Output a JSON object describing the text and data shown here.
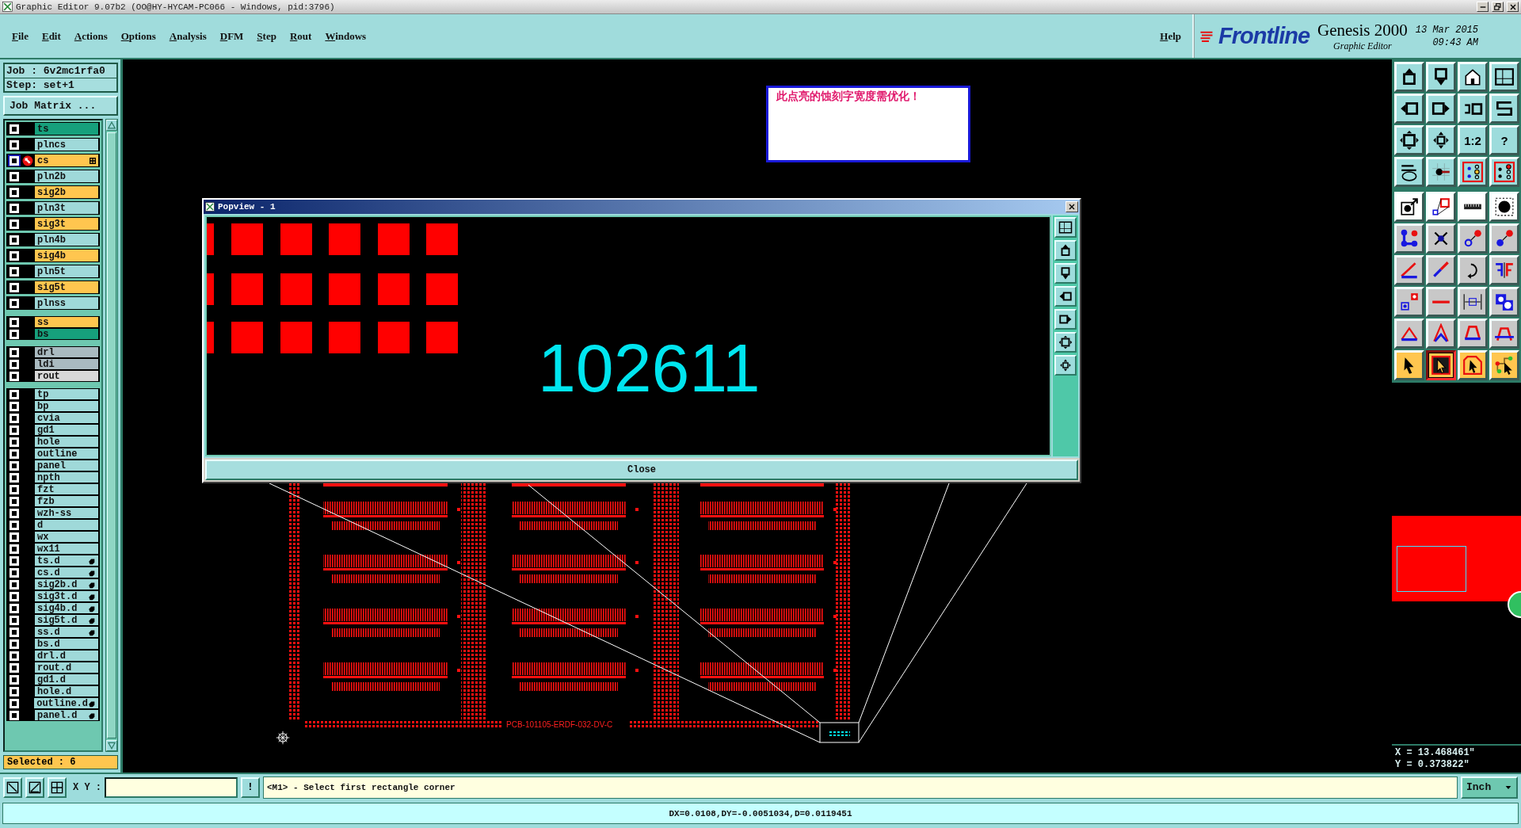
{
  "title_bar": {
    "title": "Graphic Editor 9.07b2 (OO@HY-HYCAM-PC066 - Windows, pid:3796)"
  },
  "menu": [
    "File",
    "Edit",
    "Actions",
    "Options",
    "Analysis",
    "DFM",
    "Step",
    "Rout",
    "Windows"
  ],
  "help": "Help",
  "brand": {
    "logo": "Frontline",
    "product": "Genesis 2000",
    "subtitle": "Graphic Editor",
    "date": "13 Mar 2015",
    "time": "09:43 AM"
  },
  "job": {
    "job": "Job : 6v2mc1rfa0",
    "step": "Step: set+1",
    "matrix_button": "Job Matrix ..."
  },
  "layer_groups": [
    {
      "layers": [
        {
          "name": "ts",
          "color": "#16a07c",
          "selected": false,
          "marked": false
        },
        {
          "name": "plncs",
          "color": "#9fd9d9",
          "selected": false,
          "marked": false
        },
        {
          "name": "cs",
          "color": "#ffc64f",
          "selected": true,
          "marked": false
        },
        {
          "name": "pln2b",
          "color": "#9fd9d9",
          "selected": false,
          "marked": false
        },
        {
          "name": "sig2b",
          "color": "#ffc64f",
          "selected": false,
          "marked": false
        },
        {
          "name": "pln3t",
          "color": "#9fd9d9",
          "selected": false,
          "marked": false
        },
        {
          "name": "sig3t",
          "color": "#ffc64f",
          "selected": false,
          "marked": false
        },
        {
          "name": "pln4b",
          "color": "#9fd9d9",
          "selected": false,
          "marked": false
        },
        {
          "name": "sig4b",
          "color": "#ffc64f",
          "selected": false,
          "marked": false
        },
        {
          "name": "pln5t",
          "color": "#9fd9d9",
          "selected": false,
          "marked": false
        },
        {
          "name": "sig5t",
          "color": "#ffc64f",
          "selected": false,
          "marked": false
        },
        {
          "name": "plnss",
          "color": "#9fd9d9",
          "selected": false,
          "marked": false
        }
      ]
    },
    {
      "layers": [
        {
          "name": "ss",
          "color": "#ffc64f",
          "selected": false,
          "marked": false
        },
        {
          "name": "bs",
          "color": "#16a07c",
          "selected": false,
          "marked": false
        }
      ]
    },
    {
      "layers": [
        {
          "name": "drl",
          "color": "#a9bac0",
          "selected": false,
          "marked": false
        },
        {
          "name": "ldi",
          "color": "#a9bac0",
          "selected": false,
          "marked": false
        },
        {
          "name": "rout",
          "color": "#d8d8d8",
          "selected": false,
          "marked": false
        }
      ]
    },
    {
      "layers": [
        {
          "name": "tp",
          "color": "#9fd9d9",
          "selected": false,
          "marked": false
        },
        {
          "name": "bp",
          "color": "#9fd9d9",
          "selected": false,
          "marked": false
        },
        {
          "name": "cvia",
          "color": "#9fd9d9",
          "selected": false,
          "marked": false
        },
        {
          "name": "gd1",
          "color": "#9fd9d9",
          "selected": false,
          "marked": false
        },
        {
          "name": "hole",
          "color": "#9fd9d9",
          "selected": false,
          "marked": false
        },
        {
          "name": "outline",
          "color": "#9fd9d9",
          "selected": false,
          "marked": false
        },
        {
          "name": "panel",
          "color": "#9fd9d9",
          "selected": false,
          "marked": false
        },
        {
          "name": "npth",
          "color": "#9fd9d9",
          "selected": false,
          "marked": false
        },
        {
          "name": "fzt",
          "color": "#9fd9d9",
          "selected": false,
          "marked": false
        },
        {
          "name": "fzb",
          "color": "#9fd9d9",
          "selected": false,
          "marked": false
        },
        {
          "name": "wzh-ss",
          "color": "#9fd9d9",
          "selected": false,
          "marked": false
        },
        {
          "name": "d",
          "color": "#9fd9d9",
          "selected": false,
          "marked": false
        },
        {
          "name": "wx",
          "color": "#9fd9d9",
          "selected": false,
          "marked": false
        },
        {
          "name": "wx11",
          "color": "#9fd9d9",
          "selected": false,
          "marked": false
        },
        {
          "name": "ts.d",
          "color": "#9fd9d9",
          "selected": false,
          "marked": true
        },
        {
          "name": "cs.d",
          "color": "#9fd9d9",
          "selected": false,
          "marked": true
        },
        {
          "name": "sig2b.d",
          "color": "#9fd9d9",
          "selected": false,
          "marked": true
        },
        {
          "name": "sig3t.d",
          "color": "#9fd9d9",
          "selected": false,
          "marked": true
        },
        {
          "name": "sig4b.d",
          "color": "#9fd9d9",
          "selected": false,
          "marked": true
        },
        {
          "name": "sig5t.d",
          "color": "#9fd9d9",
          "selected": false,
          "marked": true
        },
        {
          "name": "ss.d",
          "color": "#9fd9d9",
          "selected": false,
          "marked": true
        },
        {
          "name": "bs.d",
          "color": "#9fd9d9",
          "selected": false,
          "marked": false
        },
        {
          "name": "drl.d",
          "color": "#9fd9d9",
          "selected": false,
          "marked": false
        },
        {
          "name": "rout.d",
          "color": "#9fd9d9",
          "selected": false,
          "marked": false
        },
        {
          "name": "gd1.d",
          "color": "#9fd9d9",
          "selected": false,
          "marked": false
        },
        {
          "name": "hole.d",
          "color": "#9fd9d9",
          "selected": false,
          "marked": false
        },
        {
          "name": "outline.d",
          "color": "#9fd9d9",
          "selected": false,
          "marked": true
        },
        {
          "name": "panel.d",
          "color": "#9fd9d9",
          "selected": false,
          "marked": true
        }
      ]
    }
  ],
  "selected_count": "Selected : 6",
  "note": "此点亮的蚀刻字宽度需优化！",
  "popview": {
    "title": "Popview - 1",
    "text": "102611",
    "close": "Close"
  },
  "board_label": "PCB-101105-ERDF-032-DV-C",
  "toolbar": [
    {
      "kind": "page-up",
      "color": "#9ddcdc",
      "selected": false
    },
    {
      "kind": "page-down",
      "color": "#9ddcdc",
      "selected": false
    },
    {
      "kind": "home",
      "color": "#9ddcdc",
      "selected": false
    },
    {
      "kind": "grid",
      "color": "#9ddcdc",
      "selected": false
    },
    {
      "kind": "pan-left",
      "color": "#9ddcdc",
      "selected": false
    },
    {
      "kind": "pan-right",
      "color": "#9ddcdc",
      "selected": false
    },
    {
      "kind": "undo",
      "color": "#9ddcdc",
      "selected": false
    },
    {
      "kind": "zigzag",
      "color": "#9ddcdc",
      "selected": false
    },
    {
      "kind": "zoom-fit",
      "color": "#9ddcdc",
      "selected": false
    },
    {
      "kind": "zoom-center",
      "color": "#9ddcdc",
      "selected": false
    },
    {
      "kind": "text",
      "label": "1:2",
      "color": "#9ddcdc",
      "selected": false
    },
    {
      "kind": "text",
      "label": "?",
      "color": "#9ddcdc",
      "selected": false
    },
    {
      "kind": "tools",
      "color": "#9ddcdc",
      "selected": false
    },
    {
      "kind": "snap",
      "color": "#9ddcdc",
      "selected": false
    },
    {
      "kind": "net-a",
      "color": "#9ddcdc",
      "selected": false
    },
    {
      "kind": "net-b",
      "color": "#9ddcdc",
      "selected": false
    },
    {
      "kind": "move-pad",
      "color": "#ffffff",
      "selected": false
    },
    {
      "kind": "copy-shape",
      "color": "#ffffff",
      "selected": false
    },
    {
      "kind": "ruler",
      "color": "#ffffff",
      "selected": false
    },
    {
      "kind": "pad",
      "color": "#ffffff",
      "selected": false
    },
    {
      "kind": "nodes",
      "color": "#c8c8c8",
      "selected": false
    },
    {
      "kind": "cross",
      "color": "#c8c8c8",
      "selected": false
    },
    {
      "kind": "move-red",
      "color": "#c8c8c8",
      "selected": false
    },
    {
      "kind": "move-blue",
      "color": "#c8c8c8",
      "selected": false
    },
    {
      "kind": "angle",
      "color": "#c8c8c8",
      "selected": false
    },
    {
      "kind": "slash",
      "color": "#c8c8c8",
      "selected": false
    },
    {
      "kind": "rotate",
      "color": "#c8c8c8",
      "selected": false
    },
    {
      "kind": "mirror",
      "color": "#c8c8c8",
      "selected": false
    },
    {
      "kind": "resize",
      "color": "#c8c8c8",
      "selected": false
    },
    {
      "kind": "line",
      "color": "#c8c8c8",
      "selected": false
    },
    {
      "kind": "measure",
      "color": "#c8c8c8",
      "selected": false
    },
    {
      "kind": "blobs",
      "color": "#c8c8c8",
      "selected": false
    },
    {
      "kind": "tri-a",
      "color": "#c8c8c8",
      "selected": false
    },
    {
      "kind": "tri-b",
      "color": "#c8c8c8",
      "selected": false
    },
    {
      "kind": "tri-c",
      "color": "#c8c8c8",
      "selected": false
    },
    {
      "kind": "tri-d",
      "color": "#c8c8c8",
      "selected": false
    },
    {
      "kind": "pointer",
      "color": "#ffc64f",
      "selected": false
    },
    {
      "kind": "pointer-frame",
      "color": "#ffc64f",
      "selected": true
    },
    {
      "kind": "pointer-poly",
      "color": "#ffc64f",
      "selected": false
    },
    {
      "kind": "pointer-net",
      "color": "#ffc64f",
      "selected": false
    }
  ],
  "coords": [
    "X = 13.468461\"",
    "Y = 0.373822\""
  ],
  "xy_label": "X Y :",
  "bang": "!",
  "prompt": "<M1> - Select first rectangle corner",
  "units": "Inch",
  "status": "DX=0.0108,DY=-0.0051034,D=0.0119451"
}
